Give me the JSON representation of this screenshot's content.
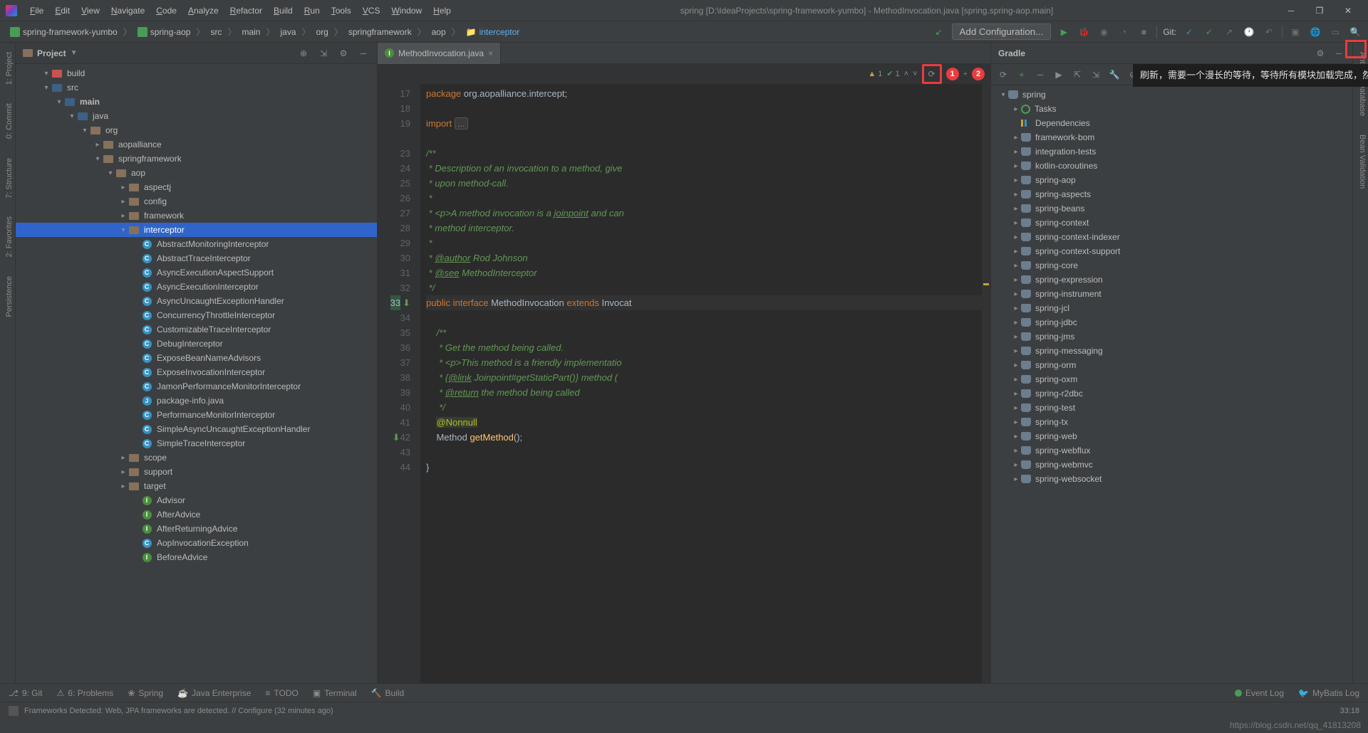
{
  "menubar": [
    "File",
    "Edit",
    "View",
    "Navigate",
    "Code",
    "Analyze",
    "Refactor",
    "Build",
    "Run",
    "Tools",
    "VCS",
    "Window",
    "Help"
  ],
  "title": "spring [D:\\IdeaProjects\\spring-framework-yumbo] - MethodInvocation.java [spring.spring-aop.main]",
  "breadcrumbs": [
    "spring-framework-yumbo",
    "spring-aop",
    "src",
    "main",
    "java",
    "org",
    "springframework",
    "aop",
    "interceptor"
  ],
  "run_config": "Add Configuration...",
  "git_label": "Git:",
  "project": {
    "title": "Project",
    "tree": [
      {
        "d": 1,
        "a": "v",
        "i": "orange",
        "t": "build"
      },
      {
        "d": 1,
        "a": "v",
        "i": "jfold",
        "t": "src"
      },
      {
        "d": 2,
        "a": "v",
        "i": "jfold",
        "t": "main",
        "b": true
      },
      {
        "d": 3,
        "a": "v",
        "i": "jfold",
        "t": "java"
      },
      {
        "d": 4,
        "a": "v",
        "i": "fold",
        "t": "org"
      },
      {
        "d": 5,
        "a": ">",
        "i": "fold",
        "t": "aopalliance"
      },
      {
        "d": 5,
        "a": "v",
        "i": "fold",
        "t": "springframework"
      },
      {
        "d": 6,
        "a": "v",
        "i": "fold",
        "t": "aop"
      },
      {
        "d": 7,
        "a": ">",
        "i": "fold",
        "t": "aspectj"
      },
      {
        "d": 7,
        "a": ">",
        "i": "fold",
        "t": "config"
      },
      {
        "d": 7,
        "a": ">",
        "i": "fold",
        "t": "framework"
      },
      {
        "d": 7,
        "a": "v",
        "i": "fold",
        "t": "interceptor",
        "sel": true
      },
      {
        "d": 8,
        "a": "",
        "i": "C",
        "t": "AbstractMonitoringInterceptor"
      },
      {
        "d": 8,
        "a": "",
        "i": "C",
        "t": "AbstractTraceInterceptor"
      },
      {
        "d": 8,
        "a": "",
        "i": "C",
        "t": "AsyncExecutionAspectSupport"
      },
      {
        "d": 8,
        "a": "",
        "i": "C",
        "t": "AsyncExecutionInterceptor"
      },
      {
        "d": 8,
        "a": "",
        "i": "C",
        "t": "AsyncUncaughtExceptionHandler"
      },
      {
        "d": 8,
        "a": "",
        "i": "C",
        "t": "ConcurrencyThrottleInterceptor"
      },
      {
        "d": 8,
        "a": "",
        "i": "C",
        "t": "CustomizableTraceInterceptor"
      },
      {
        "d": 8,
        "a": "",
        "i": "C",
        "t": "DebugInterceptor"
      },
      {
        "d": 8,
        "a": "",
        "i": "C",
        "t": "ExposeBeanNameAdvisors"
      },
      {
        "d": 8,
        "a": "",
        "i": "C",
        "t": "ExposeInvocationInterceptor"
      },
      {
        "d": 8,
        "a": "",
        "i": "C",
        "t": "JamonPerformanceMonitorInterceptor"
      },
      {
        "d": 8,
        "a": "",
        "i": "J",
        "t": "package-info.java"
      },
      {
        "d": 8,
        "a": "",
        "i": "C",
        "t": "PerformanceMonitorInterceptor"
      },
      {
        "d": 8,
        "a": "",
        "i": "C",
        "t": "SimpleAsyncUncaughtExceptionHandler"
      },
      {
        "d": 8,
        "a": "",
        "i": "C",
        "t": "SimpleTraceInterceptor"
      },
      {
        "d": 7,
        "a": ">",
        "i": "fold",
        "t": "scope"
      },
      {
        "d": 7,
        "a": ">",
        "i": "fold",
        "t": "support"
      },
      {
        "d": 7,
        "a": ">",
        "i": "fold",
        "t": "target"
      },
      {
        "d": 8,
        "a": "",
        "i": "I",
        "t": "Advisor"
      },
      {
        "d": 8,
        "a": "",
        "i": "I",
        "t": "AfterAdvice"
      },
      {
        "d": 8,
        "a": "",
        "i": "I",
        "t": "AfterReturningAdvice"
      },
      {
        "d": 8,
        "a": "",
        "i": "C",
        "t": "AopInvocationException"
      },
      {
        "d": 8,
        "a": "",
        "i": "I",
        "t": "BeforeAdvice"
      }
    ]
  },
  "editor": {
    "tab_name": "MethodInvocation.java",
    "warnings": "1",
    "oks": "1",
    "annotations": {
      "num1": "1",
      "num2": "2"
    },
    "tooltip": "刷新，需要一个漫长的等待，等待所有模块加载完成，然后进行编译",
    "lines": [
      {
        "n": 17,
        "html": "<span class='kw'>package</span> <span class='type'>org.aopalliance.intercept</span>;"
      },
      {
        "n": 18,
        "html": ""
      },
      {
        "n": 19,
        "html": "<span class='kw'>import</span> <span class='folded'>...</span>"
      },
      {
        "n": "",
        "html": ""
      },
      {
        "n": 23,
        "html": "<span class='doc'>/**</span>"
      },
      {
        "n": 24,
        "html": "<span class='doc'> * Description of an invocation to a method, give</span>"
      },
      {
        "n": 25,
        "html": "<span class='doc'> * upon method-call.</span>"
      },
      {
        "n": 26,
        "html": "<span class='doc'> *</span>"
      },
      {
        "n": 27,
        "html": "<span class='doc'> * &lt;p&gt;A method invocation is a <span class='doctag'>joinpoint</span> and can</span>"
      },
      {
        "n": 28,
        "html": "<span class='doc'> * method interceptor.</span>"
      },
      {
        "n": 29,
        "html": "<span class='doc'> *</span>"
      },
      {
        "n": 30,
        "html": "<span class='doc'> * <span class='doctag'>@author</span> Rod Johnson</span>"
      },
      {
        "n": 31,
        "html": "<span class='doc'> * <span class='doctag'>@see</span> MethodInterceptor</span>"
      },
      {
        "n": 32,
        "html": "<span class='doc'> */</span>"
      },
      {
        "n": 33,
        "html": "<span class='kw'>public</span> <span class='kw'>interface</span> <span class='type'>MethodInvocation</span> <span class='kw'>extends</span> <span class='type'>Invocat</span>",
        "hl": true
      },
      {
        "n": 34,
        "html": ""
      },
      {
        "n": 35,
        "html": "    <span class='doc'>/**</span>"
      },
      {
        "n": 36,
        "html": "    <span class='doc'> * Get the method being called.</span>"
      },
      {
        "n": 37,
        "html": "    <span class='doc'> * &lt;p&gt;This method is a friendly implementatio</span>"
      },
      {
        "n": 38,
        "html": "    <span class='doc'> * {<span class='doctag'>@link</span> Joinpoint#getStaticPart()} method (</span>"
      },
      {
        "n": 39,
        "html": "    <span class='doc'> * <span class='doctag'>@return</span> the method being called</span>"
      },
      {
        "n": 40,
        "html": "    <span class='doc'> */</span>"
      },
      {
        "n": 41,
        "html": "    <span class='ann'>@Nonnull</span>"
      },
      {
        "n": 42,
        "html": "    <span class='type'>Method</span> <span class='fn'>getMethod</span>();"
      },
      {
        "n": 43,
        "html": ""
      },
      {
        "n": 44,
        "html": "}"
      }
    ]
  },
  "gradle": {
    "title": "Gradle",
    "root": "spring",
    "tasks_label": "Tasks",
    "deps_label": "Dependencies",
    "modules": [
      "framework-bom",
      "integration-tests",
      "kotlin-coroutines",
      "spring-aop",
      "spring-aspects",
      "spring-beans",
      "spring-context",
      "spring-context-indexer",
      "spring-context-support",
      "spring-core",
      "spring-expression",
      "spring-instrument",
      "spring-jcl",
      "spring-jdbc",
      "spring-jms",
      "spring-messaging",
      "spring-orm",
      "spring-oxm",
      "spring-r2dbc",
      "spring-test",
      "spring-tx",
      "spring-web",
      "spring-webflux",
      "spring-webmvc",
      "spring-websocket"
    ]
  },
  "left_tabs": [
    "1: Project",
    "0: Commit",
    "7: Structure",
    "2: Favorites",
    "Persistence"
  ],
  "right_tabs": [
    "Ant",
    "Database",
    "Bean Validation"
  ],
  "bottom_tabs": [
    {
      "icon": "git",
      "label": "9: Git"
    },
    {
      "icon": "warn",
      "label": "6: Problems"
    },
    {
      "icon": "spring",
      "label": "Spring"
    },
    {
      "icon": "jee",
      "label": "Java Enterprise"
    },
    {
      "icon": "todo",
      "label": "TODO"
    },
    {
      "icon": "term",
      "label": "Terminal"
    },
    {
      "icon": "build",
      "label": "Build"
    }
  ],
  "bottom_right": [
    {
      "icon": "event",
      "label": "Event Log"
    },
    {
      "icon": "mybatis",
      "label": "MyBatis Log"
    }
  ],
  "status": {
    "text": "Frameworks Detected: Web, JPA frameworks are detected. // Configure (32 minutes ago)",
    "pos": "33:18"
  },
  "watermark": "https://blog.csdn.net/qq_41813208"
}
